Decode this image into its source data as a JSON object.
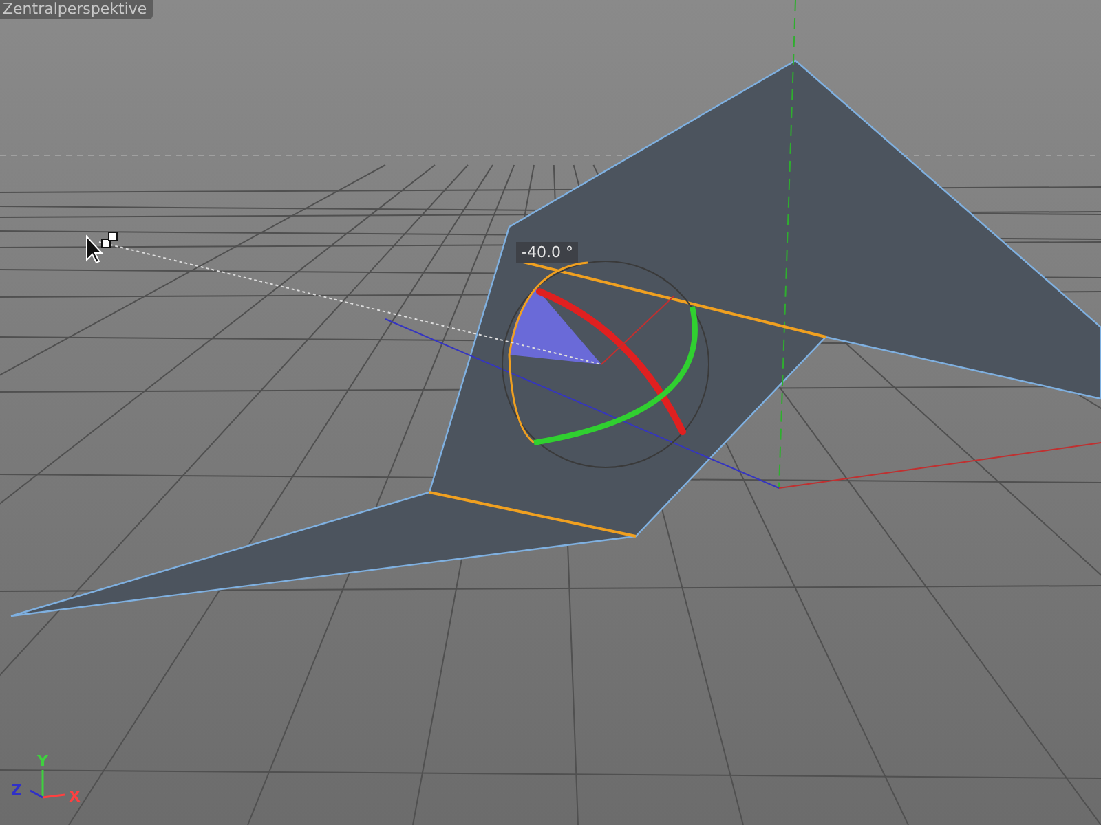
{
  "viewport": {
    "title": "Zentralperspektive",
    "rotation_readout": "-40.0 °",
    "axis_labels": [
      {
        "label": "Y",
        "color": "#3fd03f"
      },
      {
        "label": "Z",
        "color": "#3030c8"
      },
      {
        "label": "X",
        "color": "#ff4040"
      }
    ]
  }
}
